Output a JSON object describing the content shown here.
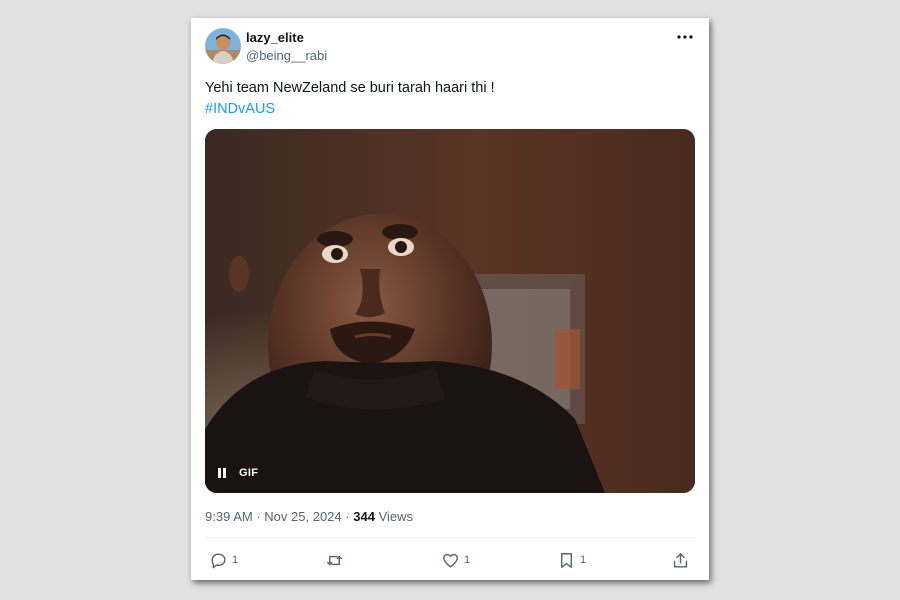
{
  "tweet": {
    "author": {
      "display_name": "lazy_elite",
      "handle": "@being__rabi"
    },
    "text": "Yehi team NewZeland se buri tarah haari thi !",
    "hashtag": "#INDvAUS",
    "media": {
      "badge": "GIF",
      "icon": "pause-icon"
    },
    "meta": {
      "time": "9:39 AM",
      "separator": "·",
      "date": "Nov 25, 2024",
      "views_count": "344",
      "views_label": "Views"
    },
    "actions": {
      "reply_count": "1",
      "retweet_count": "",
      "like_count": "1",
      "bookmark_count": "1"
    }
  },
  "colors": {
    "link": "#1d9bf0",
    "text": "#0f1419",
    "muted": "#536471",
    "background": "#e1e1e1"
  }
}
